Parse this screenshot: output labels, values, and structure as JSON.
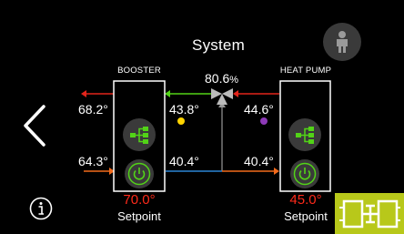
{
  "screen": {
    "title": "System"
  },
  "valve": {
    "percent_value": "80.6",
    "percent_unit": "%"
  },
  "booster": {
    "label": "BOOSTER",
    "supply_temp": "68.2°",
    "return_temp": "64.3°",
    "setpoint_value": "70.0°",
    "setpoint_label": "Setpoint"
  },
  "heat_pump": {
    "label": "HEAT PUMP",
    "supply_temp": "44.6°",
    "return_temp": "40.4°",
    "setpoint_value": "45.0°",
    "setpoint_label": "Setpoint"
  },
  "mid_loop": {
    "mix_temp": "43.8°",
    "return_temp": "40.4°"
  },
  "colors": {
    "hot_line": "#e3241b",
    "green_line": "#52d317",
    "blue_line": "#2a86d6",
    "orange_line": "#f26a1b",
    "yellow_dot": "#ffd400",
    "purple_dot": "#8e3ab8",
    "setpoint_red": "#ff2a1a",
    "badge_bg": "#b8c81a"
  },
  "icons": {
    "back": "chevron-left-icon",
    "info": "info-icon",
    "user": "person-icon",
    "network": "network-tree-icon",
    "power": "power-icon",
    "layout": "system-layout-icon"
  }
}
